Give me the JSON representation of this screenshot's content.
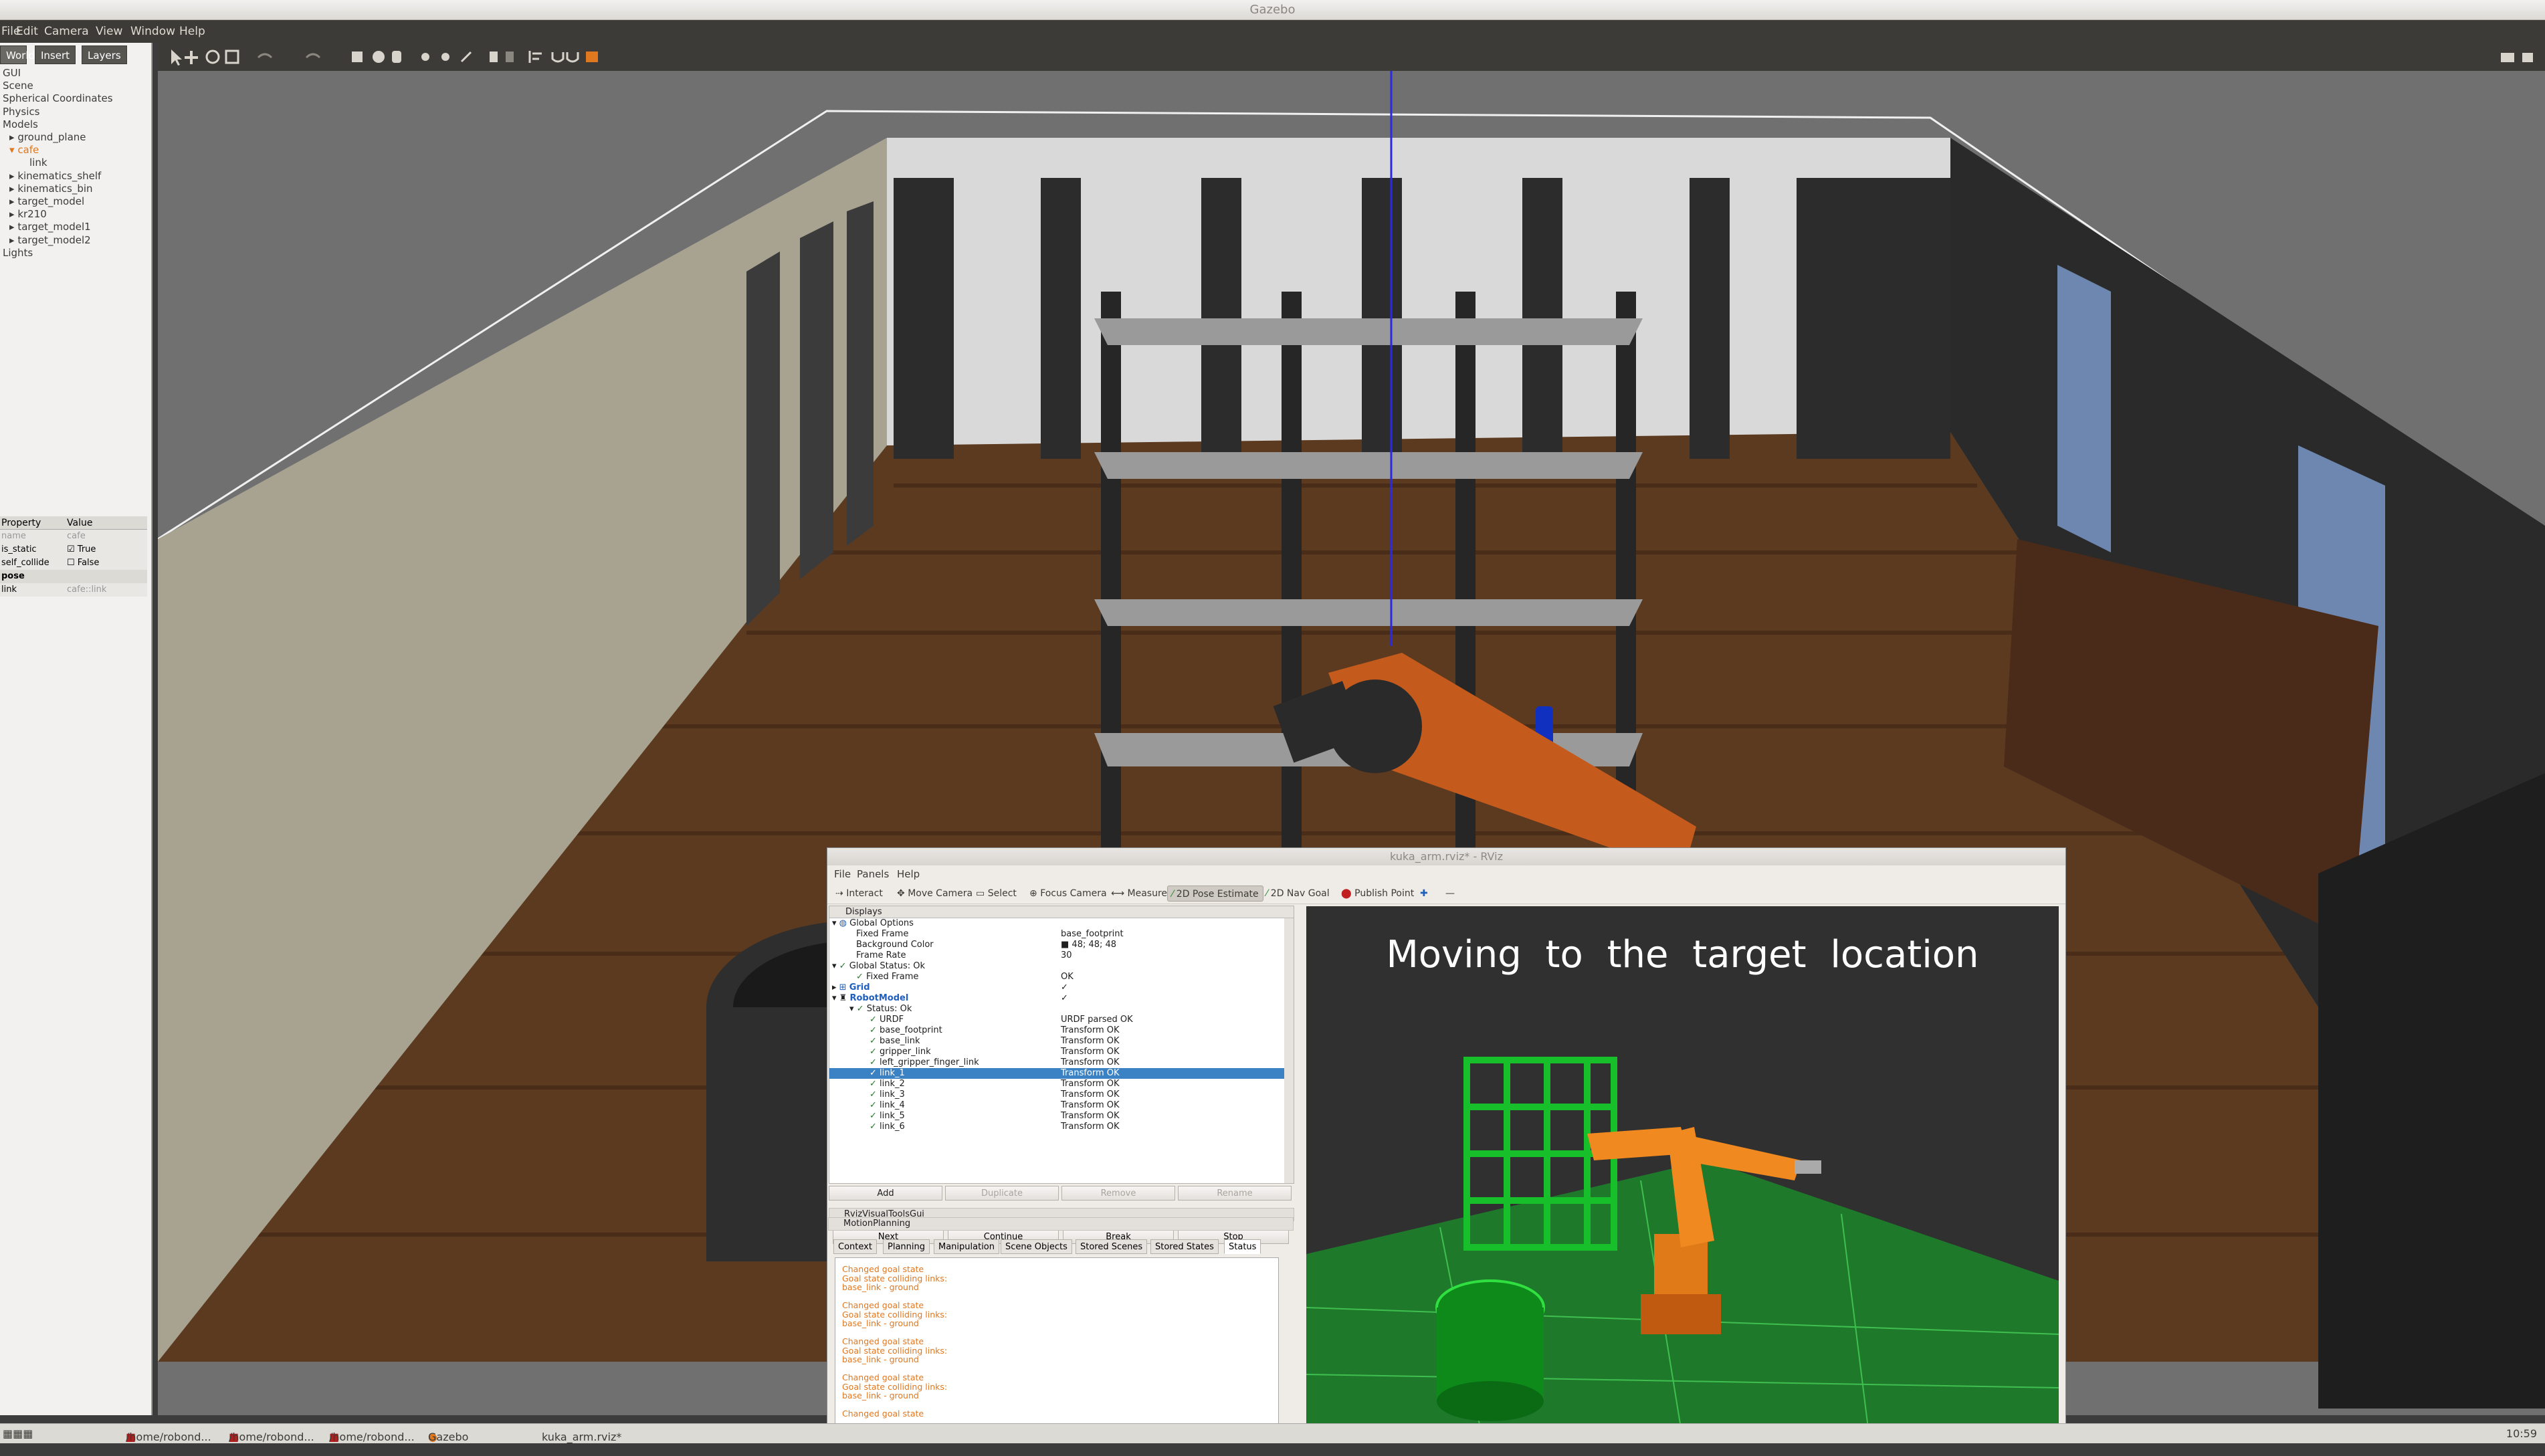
{
  "window": {
    "title": "Gazebo"
  },
  "menu": [
    "File",
    "Edit",
    "Camera",
    "View",
    "Window",
    "Help"
  ],
  "left_tabs": [
    "World",
    "Insert",
    "Layers"
  ],
  "world_tree": [
    "GUI",
    "Scene",
    "Spherical Coordinates",
    "Physics",
    "Models",
    "ground_plane",
    "cafe",
    "link",
    "kinematics_shelf",
    "kinematics_bin",
    "target_model",
    "kr210",
    "target_model1",
    "target_model2",
    "Lights"
  ],
  "properties": {
    "header": [
      "Property",
      "Value"
    ],
    "rows": [
      {
        "k": "name",
        "v": "cafe"
      },
      {
        "k": "is_static",
        "v": "True"
      },
      {
        "k": "self_collide",
        "v": "False"
      },
      {
        "k": "pose",
        "v": ""
      },
      {
        "k": "link",
        "v": "cafe::link"
      }
    ]
  },
  "taskbar": {
    "items": [
      "/home/robond...",
      "/home/robond...",
      "/home/robond...",
      "Gazebo",
      "kuka_arm.rviz* ..."
    ],
    "clock": "10:59"
  },
  "rviz": {
    "title": "kuka_arm.rviz* - RViz",
    "menu": [
      "File",
      "Panels",
      "Help"
    ],
    "tools": [
      "Interact",
      "Move Camera",
      "Select",
      "Focus Camera",
      "Measure",
      "2D Pose Estimate",
      "2D Nav Goal",
      "Publish Point"
    ],
    "displays_title": "Displays",
    "displays": [
      {
        "k": "Global Options",
        "v": ""
      },
      {
        "k": "Fixed Frame",
        "v": "base_footprint"
      },
      {
        "k": "Background Color",
        "v": "48; 48; 48"
      },
      {
        "k": "Frame Rate",
        "v": "30"
      },
      {
        "k": "Global Status: Ok",
        "v": ""
      },
      {
        "k": "Fixed Frame",
        "v": "OK"
      },
      {
        "k": "Grid",
        "v": "✓"
      },
      {
        "k": "RobotModel",
        "v": "✓"
      },
      {
        "k": "Status: Ok",
        "v": ""
      },
      {
        "k": "URDF",
        "v": "URDF parsed OK"
      },
      {
        "k": "base_footprint",
        "v": "Transform OK"
      },
      {
        "k": "base_link",
        "v": "Transform OK"
      },
      {
        "k": "gripper_link",
        "v": "Transform OK"
      },
      {
        "k": "left_gripper_finger_link",
        "v": "Transform OK"
      },
      {
        "k": "link_1",
        "v": "Transform OK"
      },
      {
        "k": "link_2",
        "v": "Transform OK"
      },
      {
        "k": "link_3",
        "v": "Transform OK"
      },
      {
        "k": "link_4",
        "v": "Transform OK"
      },
      {
        "k": "link_5",
        "v": "Transform OK"
      },
      {
        "k": "link_6",
        "v": "Transform OK"
      }
    ],
    "display_buttons": [
      "Add",
      "Duplicate",
      "Remove",
      "Rename"
    ],
    "visual_tools_title": "RvizVisualToolsGui",
    "visual_tools_buttons": [
      "Next",
      "Continue",
      "Break",
      "Stop"
    ],
    "motion_title": "MotionPlanning",
    "motion_tabs": [
      "Context",
      "Planning",
      "Manipulation",
      "Scene Objects",
      "Stored Scenes",
      "Stored States",
      "Status"
    ],
    "status_lines": [
      "Changed goal state",
      "Goal state colliding links:",
      "base_link - ground",
      "",
      "Changed goal state",
      "Goal state colliding links:",
      "base_link - ground",
      "",
      "Changed goal state",
      "Goal state colliding links:",
      "base_link - ground",
      "",
      "Changed goal state",
      "Goal state colliding links:",
      "base_link - ground",
      "",
      "Changed goal state"
    ],
    "view_caption": "Moving to the target location"
  }
}
